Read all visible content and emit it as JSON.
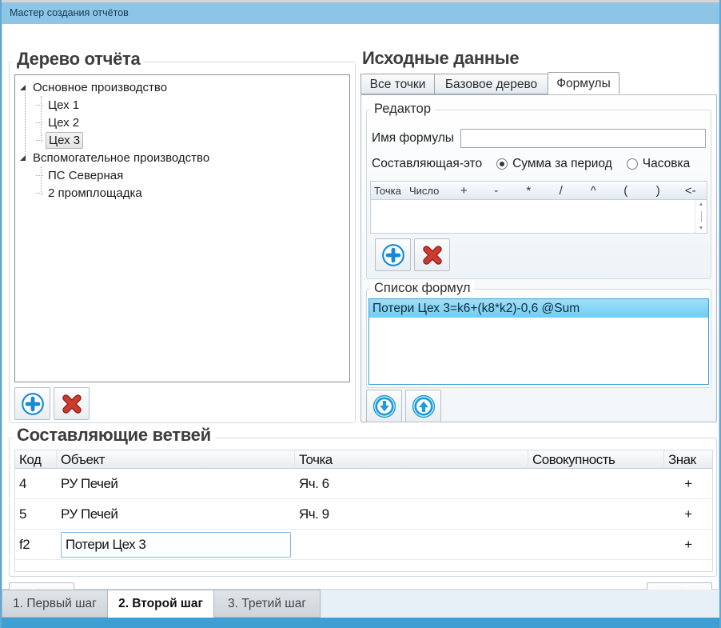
{
  "window": {
    "title": "Мастер создания отчётов"
  },
  "tree_panel": {
    "title": "Дерево отчёта",
    "items": [
      {
        "label": "Основное производство",
        "level": 0,
        "expanded": true
      },
      {
        "label": "Цех 1",
        "level": 1
      },
      {
        "label": "Цех 2",
        "level": 1
      },
      {
        "label": "Цех 3",
        "level": 1,
        "selected": true
      },
      {
        "label": "Вспомогательное производство",
        "level": 0,
        "expanded": true
      },
      {
        "label": "ПС Северная",
        "level": 1
      },
      {
        "label": "2 промплощадка",
        "level": 1
      }
    ]
  },
  "source_panel": {
    "title": "Исходные данные",
    "tabs": [
      {
        "label": "Все точки"
      },
      {
        "label": "Базовое дерево"
      },
      {
        "label": "Формулы",
        "active": true
      }
    ],
    "editor": {
      "title": "Редактор",
      "formula_name_label": "Имя формулы",
      "formula_name_value": "",
      "component_label": "Составляющая-это",
      "radio_sum": "Сумма за период",
      "radio_hour": "Часовка",
      "grid_headers": [
        "Точка",
        "Число",
        "+",
        "-",
        "*",
        "/",
        "^",
        "(",
        ")",
        "<-"
      ]
    },
    "formula_list": {
      "title": "Список формул",
      "items": [
        "Потери Цех 3=k6+(k8*k2)-0,6 @Sum"
      ]
    }
  },
  "branches_panel": {
    "title": "Составляющие ветвей",
    "columns": [
      "Код",
      "Объект",
      "Точка",
      "Совокупность",
      "Знак"
    ],
    "rows": [
      {
        "code": "4",
        "object": "РУ Печей",
        "point": "Яч. 6",
        "aggregate": "",
        "sign": "+"
      },
      {
        "code": "5",
        "object": "РУ Печей",
        "point": "Яч. 9",
        "aggregate": "",
        "sign": "+"
      },
      {
        "code": "f2",
        "object": "Потери Цех 3",
        "point": "",
        "aggregate": "",
        "sign": "+",
        "editing": true
      }
    ]
  },
  "steps": {
    "tabs": [
      {
        "label": "1. Первый шаг"
      },
      {
        "label": "2. Второй шаг",
        "active": true
      },
      {
        "label": "3. Третий шаг"
      }
    ]
  },
  "colors": {
    "titlebar": "#8cc5e6",
    "accent_blue": "#1e9cd7",
    "window_border": "#5fa8d3",
    "bottom_bar": "#3d9fd4",
    "list_selection": "#6fcdf4",
    "delete_red": "#c43227"
  }
}
